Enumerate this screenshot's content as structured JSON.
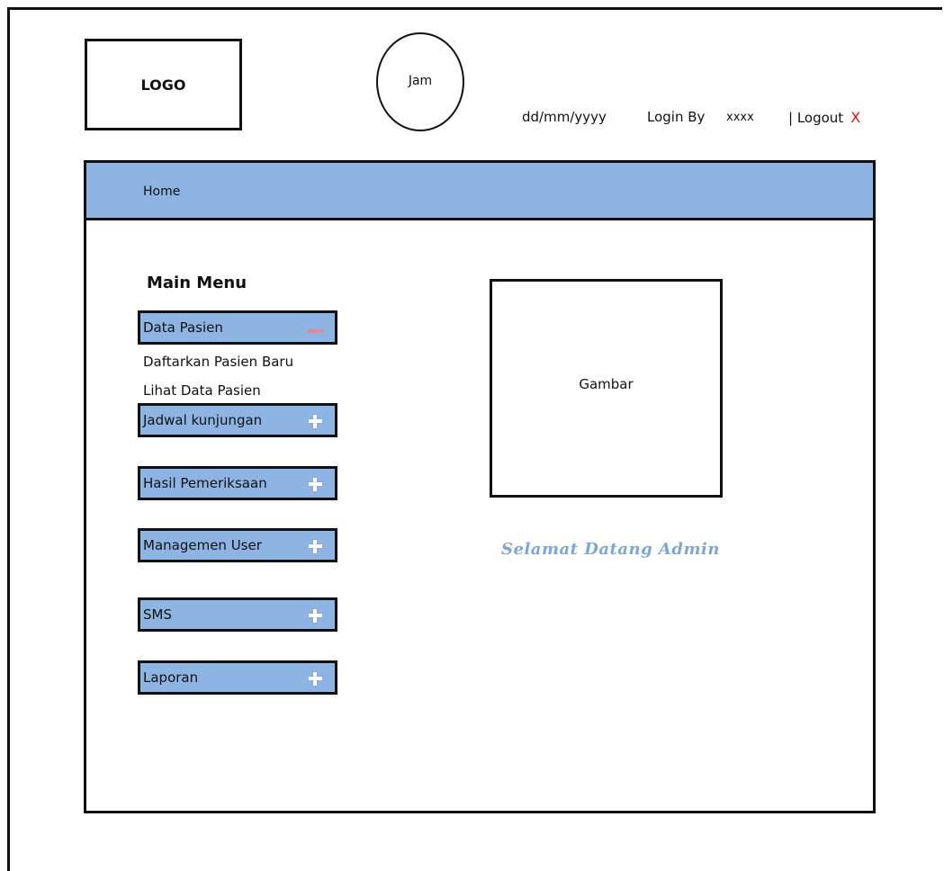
{
  "header": {
    "logo_label": "LOGO",
    "clock_label": "Jam",
    "date_format": "dd/mm/yyyy",
    "login_label": "Login By",
    "username": "xxxx",
    "logout_label": "| Logout",
    "logout_icon": "X"
  },
  "navbar": {
    "home_label": "Home"
  },
  "sidebar": {
    "title": "Main Menu",
    "items": [
      {
        "label": "Data Pasien",
        "state": "expanded"
      },
      {
        "label": "Jadwal kunjungan",
        "state": "collapsed"
      },
      {
        "label": "Hasil Pemeriksaan",
        "state": "collapsed"
      },
      {
        "label": "Managemen User",
        "state": "collapsed"
      },
      {
        "label": "SMS",
        "state": "collapsed"
      },
      {
        "label": "Laporan",
        "state": "collapsed"
      }
    ],
    "subitems": [
      "Daftarkan Pasien Baru",
      "Lihat Data Pasien"
    ]
  },
  "main": {
    "image_label": "Gambar",
    "welcome_text": "Selamat Datang Admin"
  },
  "colors": {
    "menu_bg": "#8eb4e3",
    "welcome_text": "#7ea6d6",
    "logout_icon": "#ee1111"
  }
}
